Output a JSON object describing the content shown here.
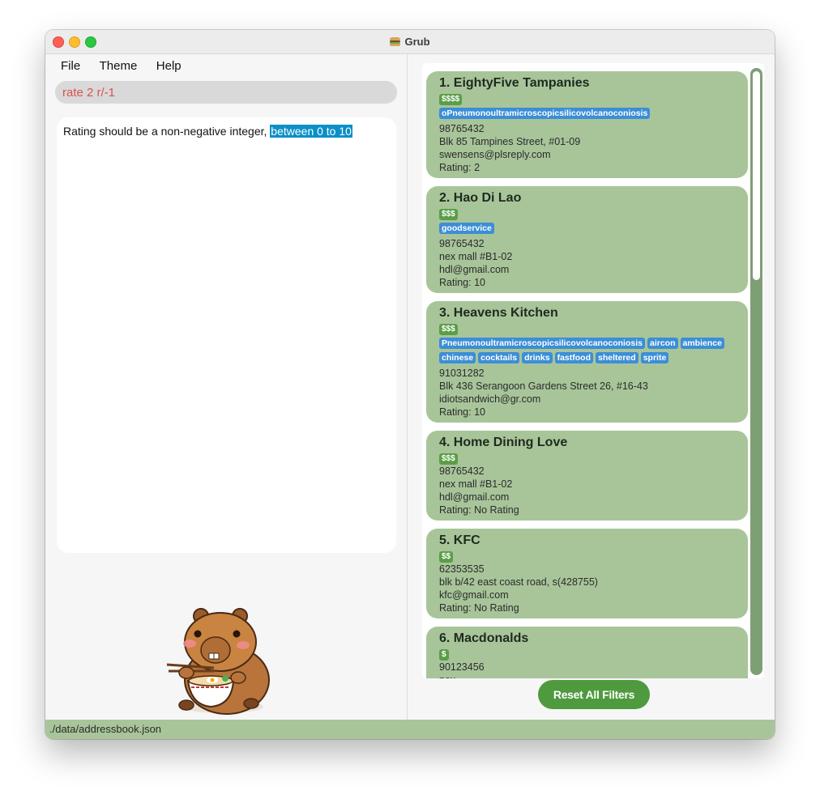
{
  "window": {
    "title": "Grub"
  },
  "menu": [
    "File",
    "Theme",
    "Help"
  ],
  "command": {
    "value": "rate 2 r/-1"
  },
  "result": {
    "text_plain": "Rating should be a non-negative integer, ",
    "text_selected": "between 0 to 10"
  },
  "restaurants": [
    {
      "title": "1. EightyFive Tampanies",
      "price": "$$$$",
      "tags": [
        "oPneumonoultramicroscopicsilicovolcanoconiosis"
      ],
      "phone": "98765432",
      "address": "Blk 85 Tampines Street, #01-09",
      "email": "swensens@plsreply.com",
      "rating": "Rating:  2"
    },
    {
      "title": "2. Hao Di Lao",
      "price": "$$$",
      "tags": [
        "goodservice"
      ],
      "phone": "98765432",
      "address": "nex mall #B1-02",
      "email": "hdl@gmail.com",
      "rating": "Rating:  10"
    },
    {
      "title": "3. Heavens Kitchen",
      "price": "$$$",
      "tags": [
        "Pneumonoultramicroscopicsilicovolcanoconiosis",
        "aircon",
        "ambience",
        "chinese",
        "cocktails",
        "drinks",
        "fastfood",
        "sheltered",
        "sprite"
      ],
      "phone": "91031282",
      "address": "Blk 436 Serangoon Gardens Street 26, #16-43",
      "email": "idiotsandwich@gr.com",
      "rating": "Rating:  10"
    },
    {
      "title": "4. Home Dining Love",
      "price": "$$$",
      "tags": [],
      "phone": "98765432",
      "address": "nex mall #B1-02",
      "email": "hdl@gmail.com",
      "rating": "Rating:  No Rating"
    },
    {
      "title": "5. KFC",
      "price": "$$",
      "tags": [],
      "phone": "62353535",
      "address": "blk b/42 east coast road, s(428755)",
      "email": "kfc@gmail.com",
      "rating": "Rating:  No Rating"
    },
    {
      "title": "6. Macdonalds",
      "price": "$",
      "tags": [],
      "phone": "90123456",
      "address": "nex",
      "email": "",
      "rating": ""
    }
  ],
  "reset_button": "Reset All Filters",
  "status": "./data/addressbook.json",
  "colors": {
    "card": "#a8c59a",
    "tag": "#3c8ed6",
    "price": "#5a9e47",
    "accent": "#4f9a3f",
    "error_text": "#d9534f"
  }
}
